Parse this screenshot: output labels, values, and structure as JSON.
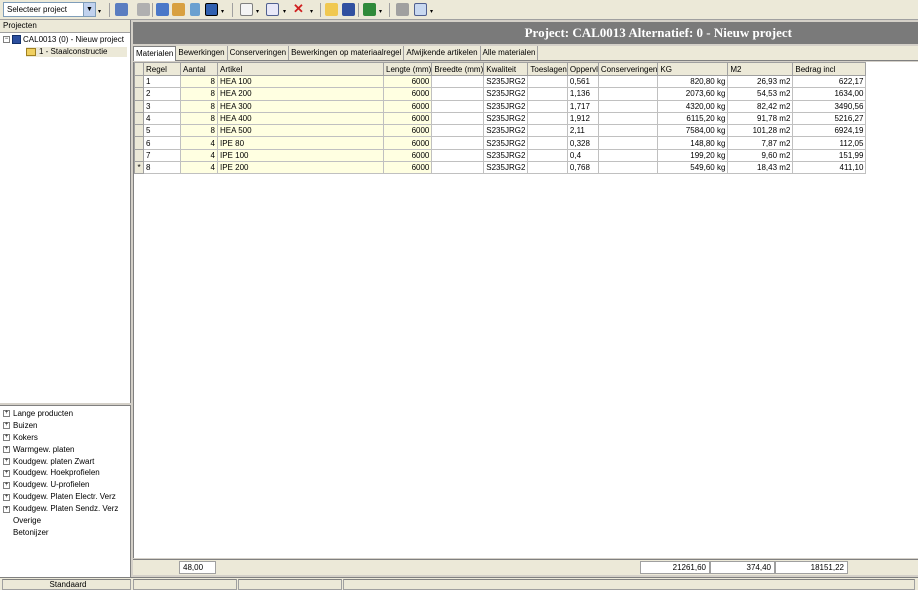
{
  "toolbar": {
    "project_select": "Selecteer project"
  },
  "projects_panel": {
    "header": "Projecten",
    "root_label": "CAL0013 (0) - Nieuw project",
    "child_label": "1 - Staalconstructie"
  },
  "categories": [
    {
      "label": "Lange producten",
      "expandable": true
    },
    {
      "label": "Buizen",
      "expandable": true
    },
    {
      "label": "Kokers",
      "expandable": true
    },
    {
      "label": "Warmgew. platen",
      "expandable": true
    },
    {
      "label": "Koudgew. platen Zwart",
      "expandable": true
    },
    {
      "label": "Koudgew. Hoekprofielen",
      "expandable": true
    },
    {
      "label": "Koudgew. U-profielen",
      "expandable": true
    },
    {
      "label": "Koudgew. Platen Electr. Verz",
      "expandable": true
    },
    {
      "label": "Koudgew. Platen Sendz. Verz",
      "expandable": true
    },
    {
      "label": "Overige",
      "expandable": false
    },
    {
      "label": "Betonijzer",
      "expandable": false
    }
  ],
  "title": "Project: CAL0013 Alternatief: 0 - Nieuw project",
  "tabs": [
    {
      "label": "Materialen",
      "active": true
    },
    {
      "label": "Bewerkingen",
      "active": false
    },
    {
      "label": "Conserveringen",
      "active": false
    },
    {
      "label": "Bewerkingen op materiaalregel",
      "active": false
    },
    {
      "label": "Afwijkende artikelen",
      "active": false
    },
    {
      "label": "Alle materialen",
      "active": false
    }
  ],
  "grid": {
    "columns": [
      "Regel",
      "Aantal",
      "Artikel",
      "Lengte (mm)",
      "Breedte (mm)",
      "Kwaliteit",
      "Toeslagen",
      "Oppervl",
      "Conserveringen",
      "KG",
      "M2",
      "Bedrag incl"
    ],
    "rows": [
      {
        "marker": "",
        "regel": "1",
        "aantal": "8",
        "artikel": "HEA  100",
        "lengte": "6000",
        "breedte": "",
        "kwaliteit": "S235JRG2",
        "toeslagen": "",
        "oppervl": "0,561",
        "conserveringen": "",
        "kg": "820,80 kg",
        "m2": "26,93 m2",
        "bedrag": "622,17"
      },
      {
        "marker": "",
        "regel": "2",
        "aantal": "8",
        "artikel": "HEA  200",
        "lengte": "6000",
        "breedte": "",
        "kwaliteit": "S235JRG2",
        "toeslagen": "",
        "oppervl": "1,136",
        "conserveringen": "",
        "kg": "2073,60 kg",
        "m2": "54,53 m2",
        "bedrag": "1634,00"
      },
      {
        "marker": "",
        "regel": "3",
        "aantal": "8",
        "artikel": "HEA  300",
        "lengte": "6000",
        "breedte": "",
        "kwaliteit": "S235JRG2",
        "toeslagen": "",
        "oppervl": "1,717",
        "conserveringen": "",
        "kg": "4320,00 kg",
        "m2": "82,42 m2",
        "bedrag": "3490,56"
      },
      {
        "marker": "",
        "regel": "4",
        "aantal": "8",
        "artikel": "HEA  400",
        "lengte": "6000",
        "breedte": "",
        "kwaliteit": "S235JRG2",
        "toeslagen": "",
        "oppervl": "1,912",
        "conserveringen": "",
        "kg": "6115,20 kg",
        "m2": "91,78 m2",
        "bedrag": "5216,27"
      },
      {
        "marker": "",
        "regel": "5",
        "aantal": "8",
        "artikel": "HEA  500",
        "lengte": "6000",
        "breedte": "",
        "kwaliteit": "S235JRG2",
        "toeslagen": "",
        "oppervl": "2,11",
        "conserveringen": "",
        "kg": "7584,00 kg",
        "m2": "101,28 m2",
        "bedrag": "6924,19"
      },
      {
        "marker": "",
        "regel": "6",
        "aantal": "4",
        "artikel": "IPE   80",
        "lengte": "6000",
        "breedte": "",
        "kwaliteit": "S235JRG2",
        "toeslagen": "",
        "oppervl": "0,328",
        "conserveringen": "",
        "kg": "148,80 kg",
        "m2": "7,87 m2",
        "bedrag": "112,05"
      },
      {
        "marker": "",
        "regel": "7",
        "aantal": "4",
        "artikel": "IPE 100",
        "lengte": "6000",
        "breedte": "",
        "kwaliteit": "S235JRG2",
        "toeslagen": "",
        "oppervl": "0,4",
        "conserveringen": "",
        "kg": "199,20 kg",
        "m2": "9,60 m2",
        "bedrag": "151,99"
      },
      {
        "marker": "*",
        "regel": "8",
        "aantal": "4",
        "artikel": "IPE 200",
        "lengte": "6000",
        "breedte": "",
        "kwaliteit": "S235JRG2",
        "toeslagen": "",
        "oppervl": "0,768",
        "conserveringen": "",
        "kg": "549,60 kg",
        "m2": "18,43 m2",
        "bedrag": "411,10"
      }
    ]
  },
  "totals": {
    "aantal": "48,00",
    "kg": "21261,60",
    "m2": "374,40",
    "bedrag": "18151,22"
  },
  "statusbar": {
    "mode": "Standaard"
  }
}
